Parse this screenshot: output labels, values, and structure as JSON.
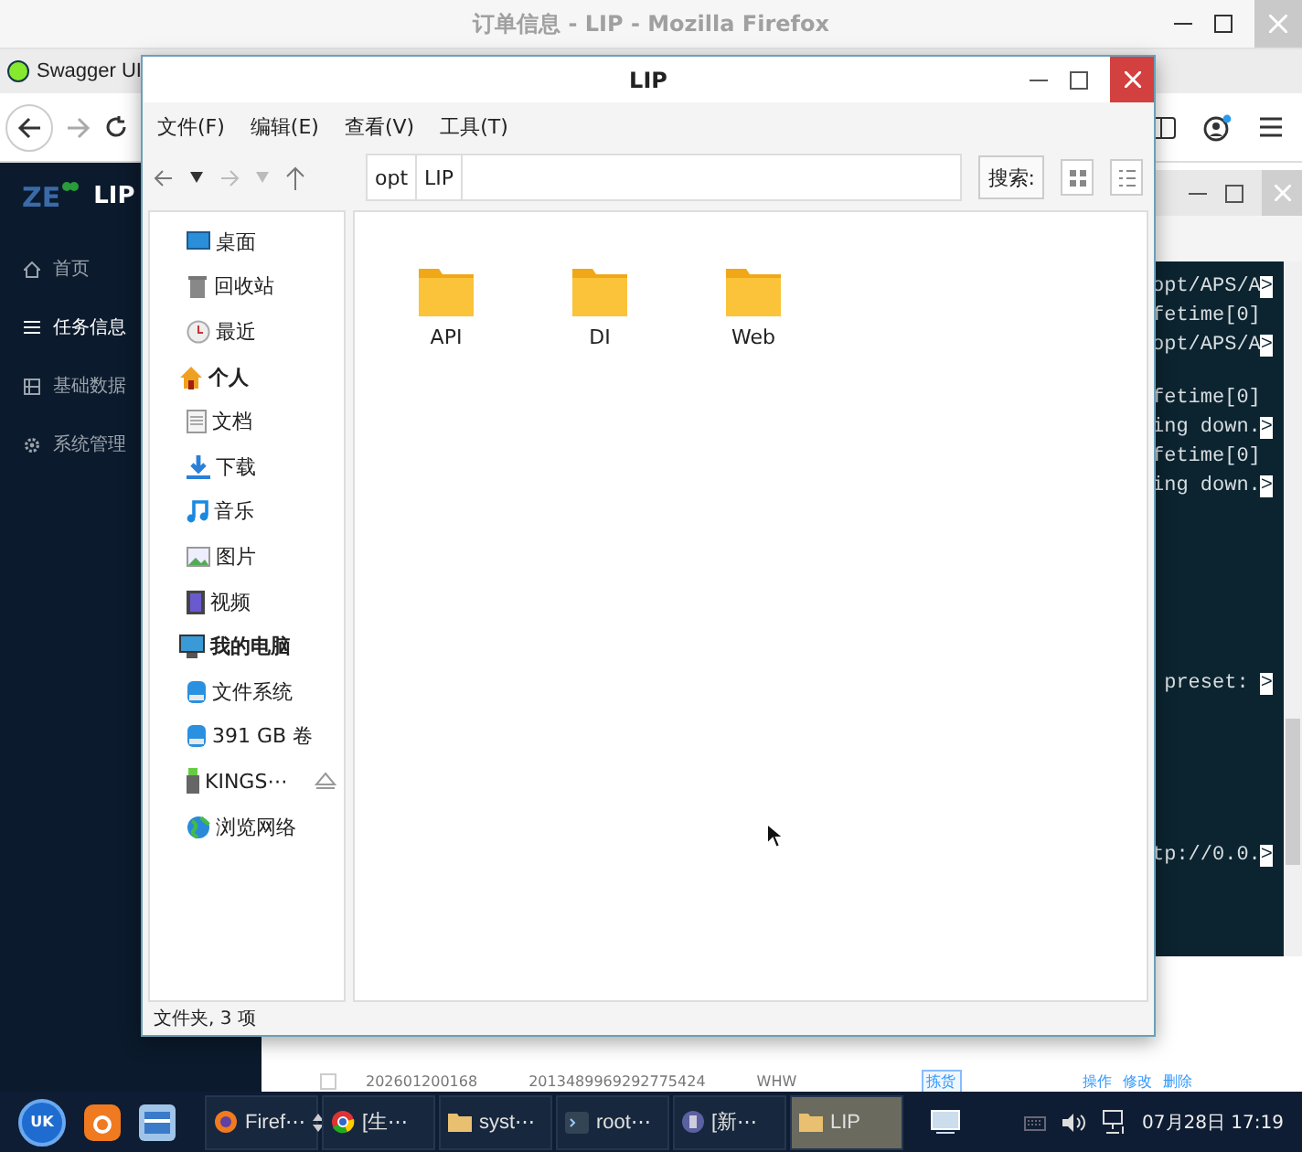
{
  "browser": {
    "title": "订单信息 - LIP - Mozilla Firefox",
    "tab": {
      "label": "Swagger UI"
    },
    "app": {
      "logo": "ZE",
      "product": "LIP",
      "nav": [
        {
          "label": "首页",
          "kind": "home",
          "selected": false
        },
        {
          "label": "任务信息",
          "kind": "list",
          "selected": true
        },
        {
          "label": "基础数据",
          "kind": "grid",
          "selected": false
        },
        {
          "label": "系统管理",
          "kind": "gear",
          "selected": false
        }
      ],
      "table_row": {
        "checked": false,
        "cells": [
          "202601200168",
          "2013489969292775424",
          "WHW"
        ],
        "tag": "拣货",
        "actions": [
          "操作",
          "修改",
          "删除"
        ]
      }
    }
  },
  "terminal": {
    "blocks": [
      [
        {
          "text": "opt/APS/A",
          "marker": ">"
        },
        {
          "text": "fetime[0]"
        },
        {
          "text": "opt/APS/A",
          "marker": ">"
        },
        {
          "text": "fetime[0]"
        },
        {
          "text": "ing down.",
          "marker": ">"
        },
        {
          "text": "fetime[0]"
        },
        {
          "text": "ing down.",
          "marker": ">"
        }
      ],
      [
        {
          "text": " preset: ",
          "marker": ">"
        }
      ],
      [
        {
          "text": "tp://0.0.",
          "marker": ">"
        }
      ]
    ]
  },
  "file_manager": {
    "title": "LIP",
    "menu": [
      "文件(F)",
      "编辑(E)",
      "查看(V)",
      "工具(T)"
    ],
    "path": [
      "opt",
      "LIP"
    ],
    "search_label": "搜索:",
    "places": [
      {
        "label": "桌面",
        "kind": "desktop"
      },
      {
        "label": "回收站",
        "kind": "trash"
      },
      {
        "label": "最近",
        "kind": "recent"
      },
      {
        "label": "个人",
        "kind": "home",
        "children": [
          {
            "label": "文档",
            "kind": "doc"
          },
          {
            "label": "下载",
            "kind": "download"
          },
          {
            "label": "音乐",
            "kind": "music"
          },
          {
            "label": "图片",
            "kind": "image"
          },
          {
            "label": "视频",
            "kind": "video"
          }
        ]
      },
      {
        "label": "我的电脑",
        "kind": "computer",
        "children": [
          {
            "label": "文件系统",
            "kind": "drive"
          },
          {
            "label": "391 GB 卷",
            "kind": "drive"
          },
          {
            "label": "KINGS⋯",
            "kind": "usb",
            "ejectable": true
          },
          {
            "label": "浏览网络",
            "kind": "network"
          }
        ]
      }
    ],
    "folders": [
      "API",
      "DI",
      "Web"
    ],
    "status": "文件夹, 3 项"
  },
  "taskbar": {
    "start_label": "UK",
    "tasks": [
      {
        "label": "Firef⋯",
        "kind": "firefox",
        "stacked": true,
        "selected": false
      },
      {
        "label": "[生⋯",
        "kind": "chrome",
        "selected": false
      },
      {
        "label": "syst⋯",
        "kind": "folder",
        "selected": false
      },
      {
        "label": "root⋯",
        "kind": "terminal",
        "selected": false
      },
      {
        "label": "[新⋯",
        "kind": "doc",
        "selected": false
      },
      {
        "label": "LIP",
        "kind": "folder",
        "selected": true
      }
    ],
    "clock": "07月28日 17:19"
  }
}
